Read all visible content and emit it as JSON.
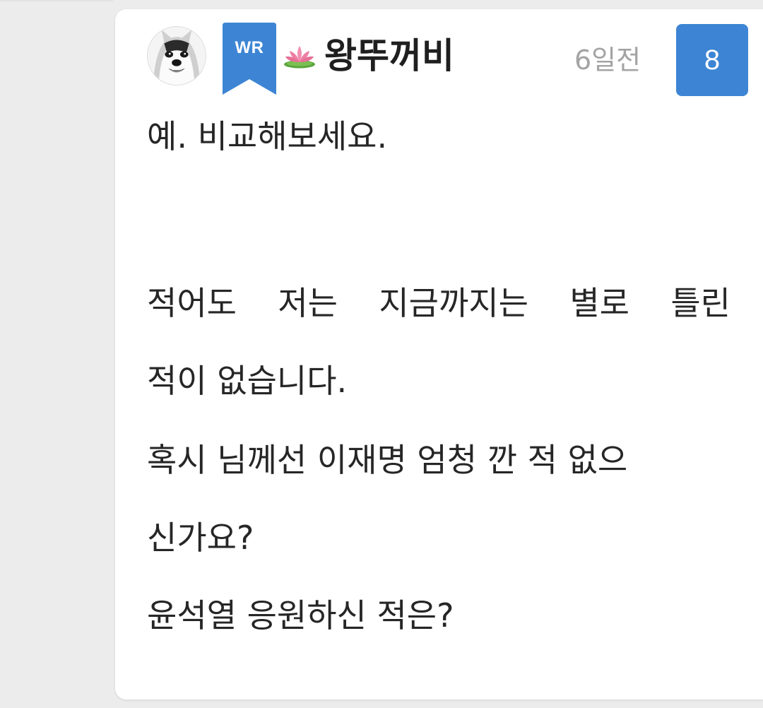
{
  "comment": {
    "author": {
      "badge": "WR",
      "name": "왕뚜꺼비",
      "icon": "lotus-icon",
      "avatar": "husky-avatar"
    },
    "time": "6일전",
    "like_count": "8",
    "lines": [
      "예. 비교해보세요.",
      "적어도 저는 지금까지는 별로 틀린",
      "적이 없습니다.",
      "혹시 님께선 이재명 엄청 깐 적 없으",
      "신가요?",
      "윤석열 응원하신 적은?"
    ],
    "line4_words": [
      "적어도",
      "저는",
      "지금까지는",
      "별로",
      "틀린"
    ]
  },
  "colors": {
    "badge": "#3d85d4",
    "like_box": "#3d85d4",
    "timestamp": "#a4a4a4",
    "text": "#262626",
    "background": "#ececec",
    "card": "#ffffff"
  }
}
